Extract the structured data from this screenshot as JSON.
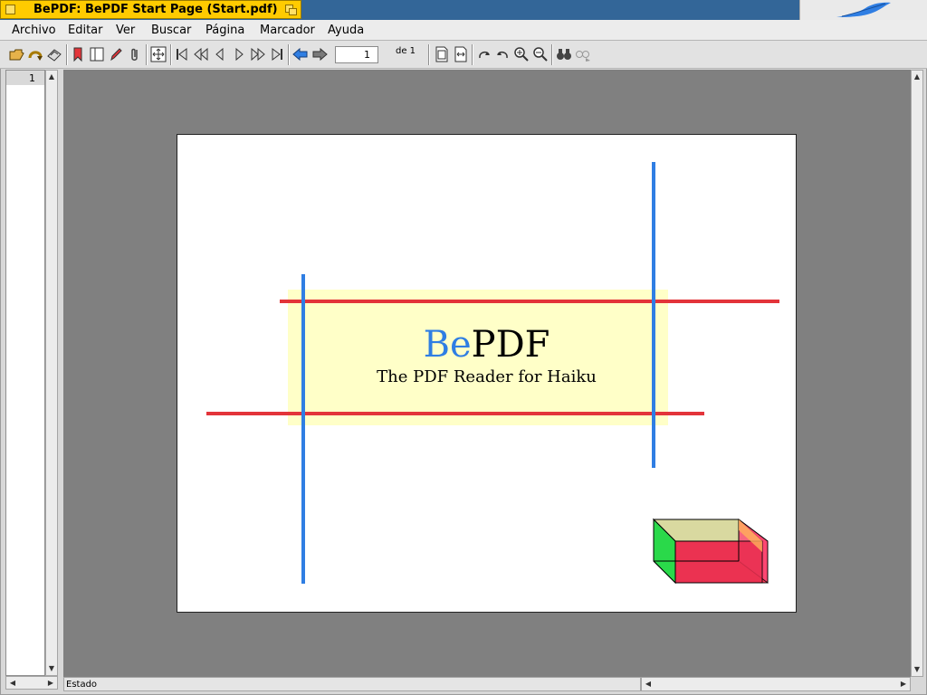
{
  "window": {
    "title": "BePDF: BePDF Start Page (Start.pdf)"
  },
  "menu": [
    "Archivo",
    "Editar",
    "Ver",
    "Buscar",
    "Página",
    "Marcador",
    "Ayuda"
  ],
  "toolbar": {
    "page_value": "1",
    "page_count": "de 1"
  },
  "thumbnails": {
    "page_number": "1"
  },
  "status": {
    "text": "Estado"
  },
  "document": {
    "logo_part1": "Be",
    "logo_part2": "PDF",
    "subtitle": "The PDF Reader for Haiku"
  },
  "colors": {
    "accent_tab": "#ffcb00",
    "logo_blue": "#2f7ee3",
    "logo_red": "#e3343a"
  }
}
